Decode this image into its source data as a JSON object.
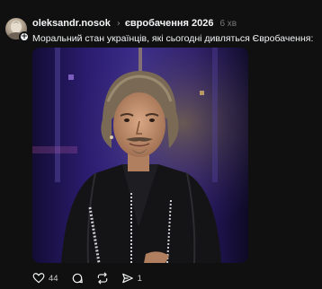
{
  "post": {
    "author": "oleksandr.nosok",
    "topic": "євробачення 2026",
    "time": "6 хв",
    "text": "Моральний стан українців, які сьогодні дивляться Євробачення:",
    "follow_badge": "+"
  },
  "actions": {
    "likes": "44",
    "comments": "",
    "reposts": "",
    "shares": "1"
  },
  "icons": [
    "heart-icon",
    "comment-icon",
    "repost-icon",
    "share-icon",
    "chevron-right-icon"
  ],
  "colors": {
    "background": "#101010",
    "text": "#f3f5f7",
    "muted": "#777777"
  }
}
